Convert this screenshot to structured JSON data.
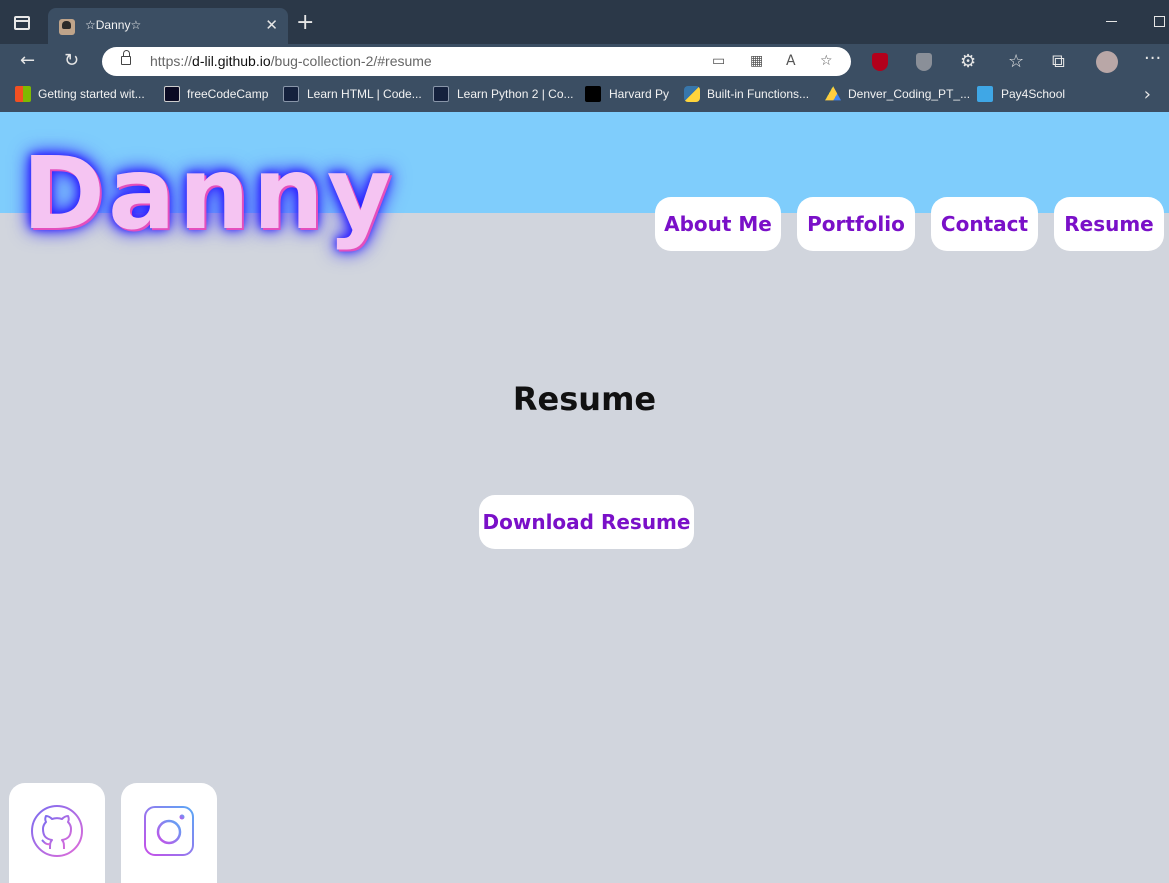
{
  "browser": {
    "tab_title": "☆Danny☆",
    "tab_close": "✕",
    "new_tab": "+",
    "url_scheme": "https://",
    "url_host": "d-lil.github.io",
    "url_path": "/bug-collection-2/#resume"
  },
  "bookmarks": [
    {
      "label": "Getting started wit...",
      "icon": "microsoft-icon"
    },
    {
      "label": "freeCodeCamp",
      "icon": "freecodecamp-icon"
    },
    {
      "label": "Learn HTML | Code...",
      "icon": "codecademy-icon"
    },
    {
      "label": "Learn Python 2 | Co...",
      "icon": "codecademy-icon"
    },
    {
      "label": "Harvard Py",
      "icon": "edx-icon"
    },
    {
      "label": "Built-in Functions...",
      "icon": "python-icon"
    },
    {
      "label": "Denver_Coding_PT_...",
      "icon": "google-drive-icon"
    },
    {
      "label": "Pay4School",
      "icon": "pay4school-icon"
    }
  ],
  "site": {
    "logo": "Danny",
    "nav": [
      "About Me",
      "Portfolio",
      "Contact",
      "Resume"
    ],
    "section_title": "Resume",
    "download_label": "Download Resume",
    "social": [
      "github-icon",
      "instagram-icon"
    ]
  },
  "colors": {
    "banner": "#7fcdfc",
    "page_bg": "#d1d5dd",
    "accent": "#7a10c8",
    "logo_fill": "#f5c4f2"
  }
}
